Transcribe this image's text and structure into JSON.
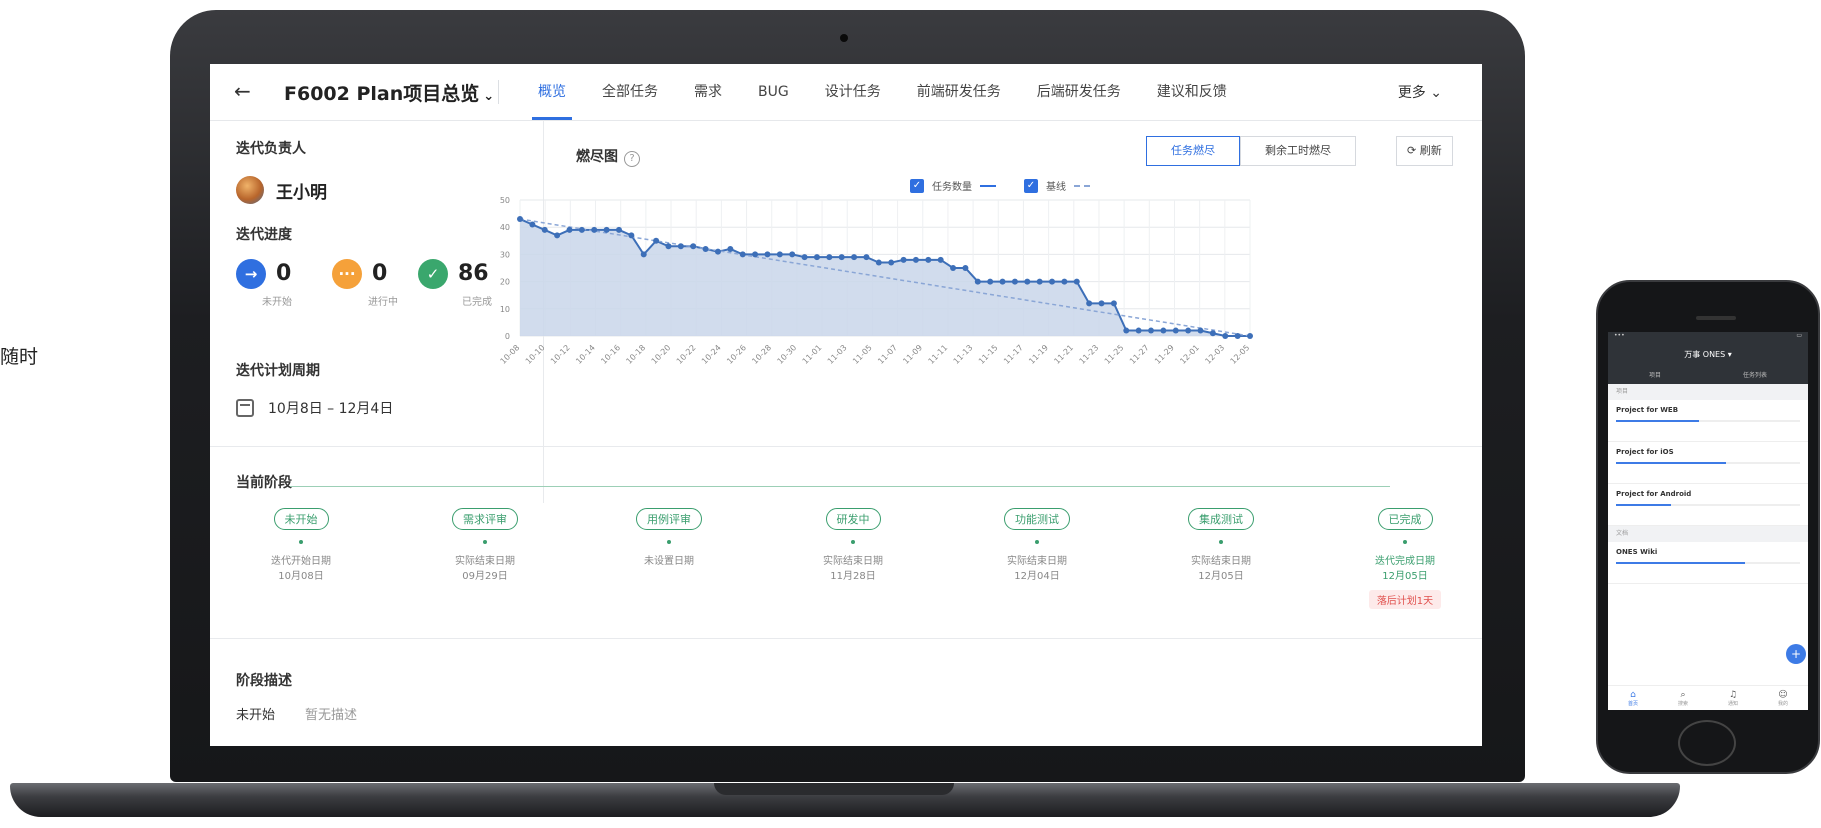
{
  "side_text": "随时",
  "header": {
    "project_title": "F6002 Plan项目总览",
    "tabs": [
      "概览",
      "全部任务",
      "需求",
      "BUG",
      "设计任务",
      "前端研发任务",
      "后端研发任务",
      "建议和反馈"
    ],
    "active_tab": 0,
    "more_label": "更多"
  },
  "left": {
    "owner_title": "迭代负责人",
    "owner_name": "王小明",
    "progress_title": "迭代进度",
    "stats": [
      {
        "value": "0",
        "label": "未开始",
        "color": "#2f6fe0"
      },
      {
        "value": "0",
        "label": "进行中",
        "color": "#f5a13a"
      },
      {
        "value": "86",
        "label": "已完成",
        "color": "#3aa76d"
      }
    ],
    "plan_title": "迭代计划周期",
    "plan_range": "10月8日 – 12月4日"
  },
  "chart_panel": {
    "title": "燃尽图",
    "segments": [
      "任务燃尽",
      "剩余工时燃尽"
    ],
    "active_segment": 0,
    "refresh_label": "刷新",
    "legend": [
      "任务数量",
      "基线"
    ]
  },
  "chart_data": {
    "type": "line",
    "title": "燃尽图",
    "ylim": [
      0,
      50
    ],
    "yticks": [
      0,
      10,
      20,
      30,
      40,
      50
    ],
    "x_tick_labels": [
      "10-08",
      "10-10",
      "10-12",
      "10-14",
      "10-16",
      "10-18",
      "10-20",
      "10-22",
      "10-24",
      "10-26",
      "10-28",
      "10-30",
      "11-01",
      "11-03",
      "11-05",
      "11-07",
      "11-09",
      "11-11",
      "11-13",
      "11-15",
      "11-17",
      "11-19",
      "11-21",
      "11-23",
      "11-25",
      "11-27",
      "11-29",
      "12-01",
      "12-03",
      "12-05"
    ],
    "grid": true,
    "series": [
      {
        "name": "任务数量",
        "color": "#3d6fb8",
        "values": [
          43,
          41,
          39,
          37,
          39,
          39,
          39,
          39,
          39,
          37,
          30,
          35,
          33,
          33,
          33,
          32,
          31,
          32,
          30,
          30,
          30,
          30,
          30,
          29,
          29,
          29,
          29,
          29,
          29,
          27,
          27,
          28,
          28,
          28,
          28,
          25,
          25,
          20,
          20,
          20,
          20,
          20,
          20,
          20,
          20,
          20,
          12,
          12,
          12,
          2,
          2,
          2,
          2,
          2,
          2,
          2,
          1,
          0,
          0,
          0
        ]
      },
      {
        "name": "基线",
        "color": "#8aa6d6",
        "dashed": true,
        "values_endpoints": [
          43,
          0
        ]
      }
    ]
  },
  "stages": {
    "title": "当前阶段",
    "items": [
      {
        "name": "未开始",
        "label": "迭代开始日期",
        "date": "10月08日"
      },
      {
        "name": "需求评审",
        "label": "实际结束日期",
        "date": "09月29日"
      },
      {
        "name": "用例评审",
        "label": "未设置日期",
        "date": ""
      },
      {
        "name": "研发中",
        "label": "实际结束日期",
        "date": "11月28日"
      },
      {
        "name": "功能测试",
        "label": "实际结束日期",
        "date": "12月04日"
      },
      {
        "name": "集成测试",
        "label": "实际结束日期",
        "date": "12月05日"
      },
      {
        "name": "已完成",
        "label": "迭代完成日期",
        "date": "12月05日",
        "badge": "落后计划1天"
      }
    ]
  },
  "description": {
    "title": "阶段描述",
    "row_name": "未开始",
    "row_value": "暂无描述"
  },
  "phone": {
    "nav_title": "万事 ONES",
    "tabs": [
      "项目",
      "任务列表"
    ],
    "group1": "项目",
    "projects": [
      {
        "name": "Project for WEB",
        "progress": 0.45
      },
      {
        "name": "Project for iOS",
        "progress": 0.6
      },
      {
        "name": "Project for Android",
        "progress": 0.3
      }
    ],
    "group2": "文档",
    "wiki": {
      "name": "ONES Wiki",
      "progress": 0.7
    },
    "tabbar": [
      "首页",
      "搜索",
      "通知",
      "我的"
    ]
  }
}
